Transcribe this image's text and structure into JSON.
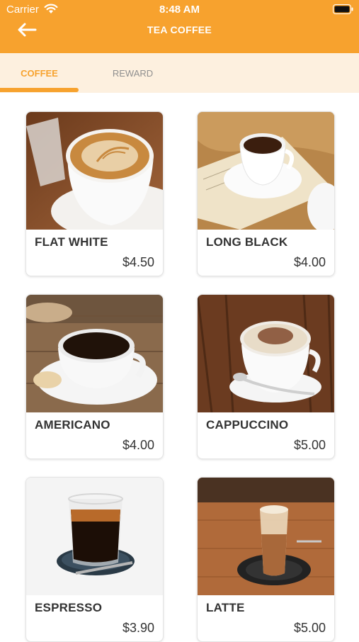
{
  "status_bar": {
    "carrier": "Carrier",
    "time": "8:48 AM"
  },
  "header": {
    "title": "TEA COFFEE",
    "back_icon": "arrow-left-icon"
  },
  "tabs": [
    {
      "label": "COFFEE",
      "active": true
    },
    {
      "label": "REWARD",
      "active": false
    }
  ],
  "colors": {
    "accent": "#f7a22e",
    "tabbar_bg": "#fdf0df",
    "text": "#333333"
  },
  "products": [
    {
      "name": "FLAT WHITE",
      "price": "$4.50"
    },
    {
      "name": "LONG BLACK",
      "price": "$4.00"
    },
    {
      "name": "AMERICANO",
      "price": "$4.00"
    },
    {
      "name": "CAPPUCCINO",
      "price": "$5.00"
    },
    {
      "name": "ESPRESSO",
      "price": "$3.90"
    },
    {
      "name": "LATTE",
      "price": "$5.00"
    }
  ]
}
